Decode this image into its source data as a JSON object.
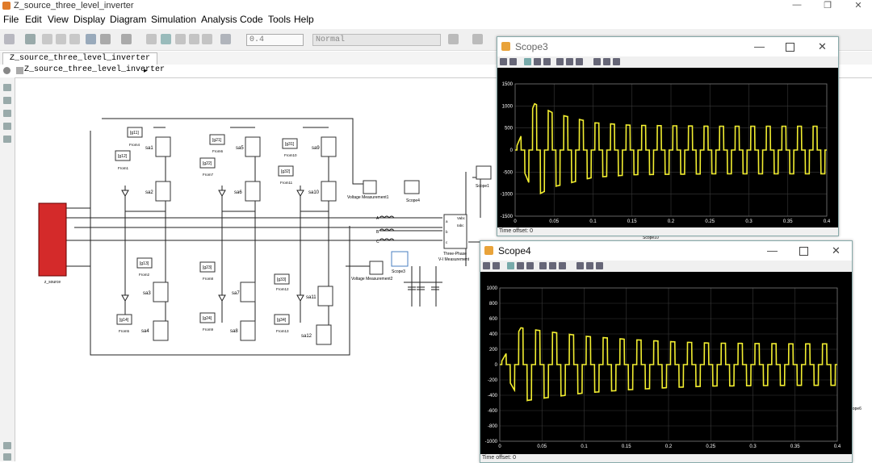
{
  "window": {
    "title": "Z_source_three_level_inverter",
    "controls": {
      "minimize": "—",
      "restore": "❐",
      "close": "✕"
    }
  },
  "menu": [
    "File",
    "Edit",
    "View",
    "Display",
    "Diagram",
    "Simulation",
    "Analysis",
    "Code",
    "Tools",
    "Help"
  ],
  "toolbar": {
    "stop_time": "0.4",
    "sim_mode": "Normal"
  },
  "tab": {
    "label": "Z_source_three_level_inverter"
  },
  "breadcrumb": {
    "path": "Z_source_three_level_inverter"
  },
  "model": {
    "source_label": "z_source",
    "goto_tags": [
      "[g11]",
      "[g12]",
      "[g21]",
      "[g22]",
      "[g31]",
      "[g32]",
      "[g13]",
      "[g14]",
      "[g23]",
      "[g24]",
      "[g33]",
      "[g34]"
    ],
    "from_labels": [
      "From4",
      "From1",
      "From6",
      "From7",
      "From10",
      "From11",
      "From2",
      "From5",
      "From8",
      "From9",
      "From12",
      "From13"
    ],
    "switch_labels": [
      "sa1",
      "sa2",
      "sa5",
      "sa6",
      "sa9",
      "sa10",
      "sa3",
      "sa4",
      "sa7",
      "sa8",
      "sa11",
      "sa12"
    ],
    "vm1": "Voltage Measurement1",
    "vm2": "Voltage Measurement2",
    "scope_labels": [
      "Scope4",
      "Scope3",
      "Scope1",
      "Scope10",
      "Scope6"
    ],
    "meas_label_1": "Three-Phase",
    "meas_label_2": "V-I Measurement",
    "meas_ports": [
      "Vabc",
      "Iabc",
      "a",
      "b",
      "c"
    ],
    "bus_labels": [
      "A",
      "B",
      "C"
    ]
  },
  "scope3": {
    "title": "Scope3",
    "time_offset": "Time offset:  0",
    "y_ticks": [
      "1500",
      "1000",
      "500",
      "0",
      "-500",
      "-1000",
      "-1500"
    ],
    "x_ticks": [
      "0",
      "0.05",
      "0.1",
      "0.15",
      "0.2",
      "0.25",
      "0.3",
      "0.35",
      "0.4"
    ]
  },
  "scope4": {
    "title": "Scope4",
    "time_offset": "Time offset:  0",
    "y_ticks": [
      "1000",
      "800",
      "600",
      "400",
      "200",
      "0",
      "-200",
      "-400",
      "-600",
      "-800",
      "-1000"
    ],
    "x_ticks": [
      "0",
      "0.05",
      "0.1",
      "0.15",
      "0.2",
      "0.25",
      "0.3",
      "0.35",
      "0.4"
    ]
  },
  "colors": {
    "trace": "#f2ee30",
    "plot_bg": "#000000",
    "source_block": "#d42a2a"
  },
  "chart_data": [
    {
      "type": "line",
      "title": "Scope3",
      "xlim": [
        0,
        0.4
      ],
      "ylim": [
        -1500,
        1500
      ],
      "grid": true,
      "series": [
        {
          "x": [
            0,
            0.025,
            0.05,
            0.1,
            0.15,
            0.2,
            0.25,
            0.3,
            0.35,
            0.4
          ],
          "y_envelope_max": [
            0,
            1050,
            830,
            620,
            560,
            550,
            540,
            540,
            540,
            540
          ],
          "y_envelope_min": [
            0,
            -1050,
            -830,
            -620,
            -560,
            -550,
            -540,
            -540,
            -540,
            -540
          ]
        }
      ]
    },
    {
      "type": "line",
      "title": "Scope4",
      "xlim": [
        0,
        0.4
      ],
      "ylim": [
        -1000,
        1000
      ],
      "grid": true,
      "series": [
        {
          "x": [
            0,
            0.025,
            0.05,
            0.1,
            0.15,
            0.2,
            0.25,
            0.3,
            0.35,
            0.4
          ],
          "y_envelope_max": [
            0,
            480,
            440,
            370,
            330,
            300,
            280,
            275,
            270,
            270
          ],
          "y_envelope_min": [
            0,
            -480,
            -440,
            -370,
            -330,
            -300,
            -280,
            -275,
            -270,
            -270
          ]
        }
      ]
    }
  ]
}
